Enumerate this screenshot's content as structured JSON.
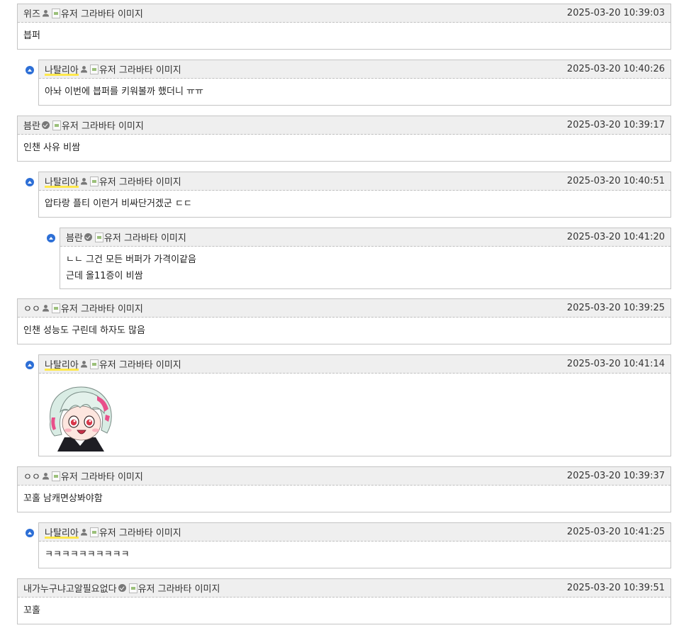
{
  "avatar_alt": "유저 그라바타 이미지",
  "comments": [
    {
      "nick": "위즈",
      "badge": "user",
      "time": "2025-03-20 10:39:03",
      "lines": [
        "븝퍼"
      ]
    },
    {
      "nick": "나탈리아",
      "badge": "user",
      "highlight": true,
      "time": "2025-03-20 10:40:26",
      "lines": [
        "아놔 이번에 븝퍼를 키워볼까 했더니 ㅠㅠ"
      ]
    },
    {
      "nick": "븜란",
      "badge": "verified",
      "time": "2025-03-20 10:39:17",
      "lines": [
        "인챈 사유 비쌈"
      ]
    },
    {
      "nick": "나탈리아",
      "badge": "user",
      "highlight": true,
      "time": "2025-03-20 10:40:51",
      "lines": [
        "압타랑 플티 이런거 비싸단거겠군 ㄷㄷ"
      ]
    },
    {
      "nick": "븜란",
      "badge": "verified",
      "time": "2025-03-20 10:41:20",
      "lines": [
        "ㄴㄴ 그건 모든 버퍼가 가격이같음",
        "근데 올11증이 비쌈"
      ]
    },
    {
      "nick": "ㅇㅇ",
      "badge": "user",
      "time": "2025-03-20 10:39:25",
      "lines": [
        "인챈 성능도 구린데 하자도 많음"
      ]
    },
    {
      "nick": "나탈리아",
      "badge": "user",
      "highlight": true,
      "time": "2025-03-20 10:41:14",
      "lines": [],
      "sticker": "anime-girl-sticker"
    },
    {
      "nick": "ㅇㅇ",
      "badge": "user",
      "time": "2025-03-20 10:39:37",
      "lines": [
        "꼬홀 남캐면상봐야함"
      ]
    },
    {
      "nick": "나탈리아",
      "badge": "user",
      "highlight": true,
      "time": "2025-03-20 10:41:25",
      "lines": [
        "ㅋㅋㅋㅋㅋㅋㅋㅋㅋㅋ"
      ]
    },
    {
      "nick": "내가누구냐고알필요없다",
      "badge": "verified",
      "time": "2025-03-20 10:39:51",
      "lines": [
        "꼬홀"
      ]
    }
  ]
}
